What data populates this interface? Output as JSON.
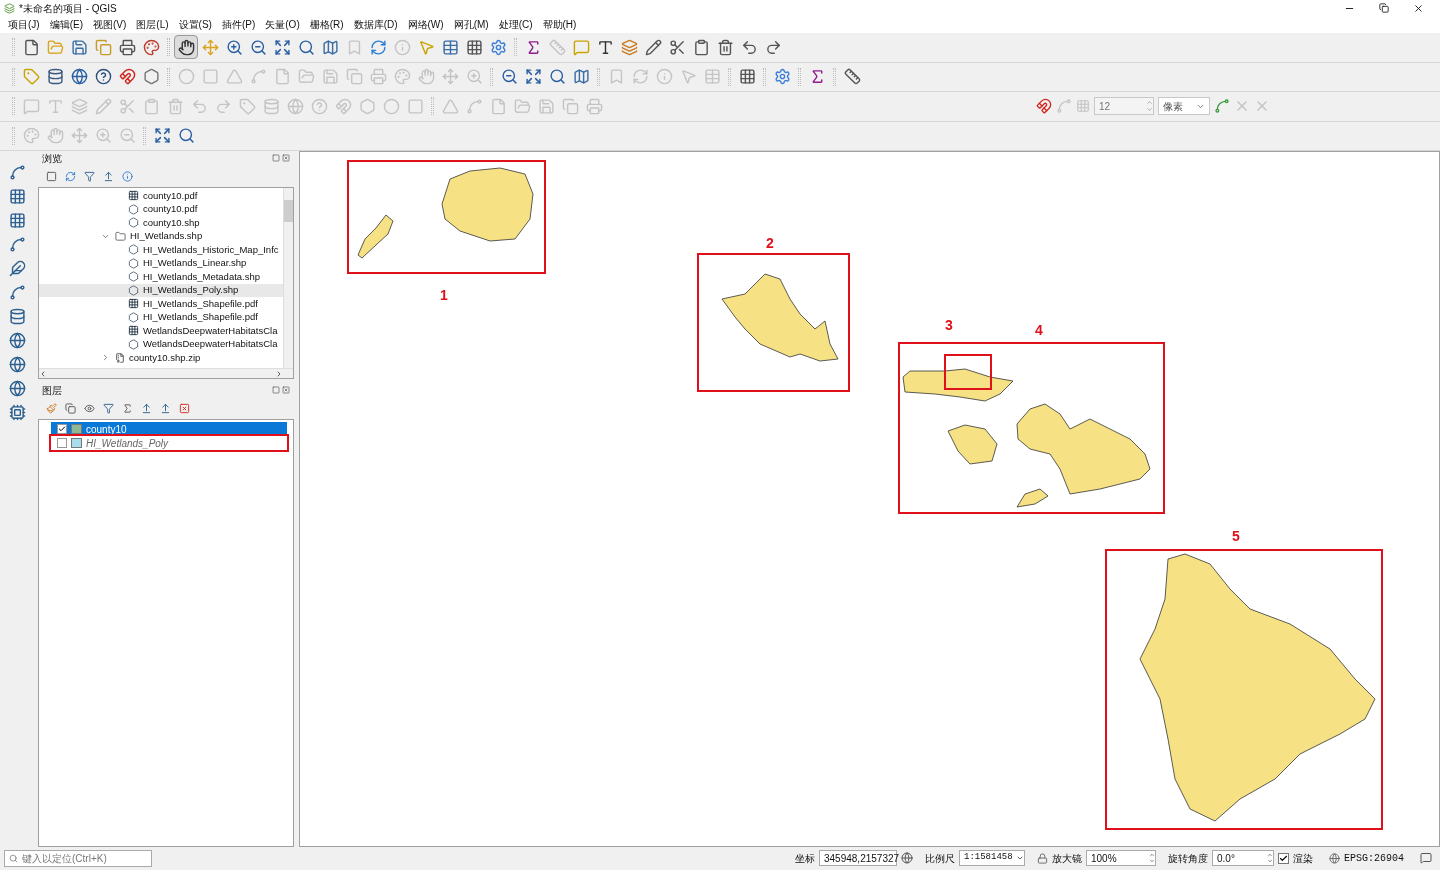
{
  "window": {
    "title": "*未命名的项目 - QGIS"
  },
  "menu": [
    "项目(J)",
    "编辑(E)",
    "视图(V)",
    "图层(L)",
    "设置(S)",
    "插件(P)",
    "矢量(O)",
    "栅格(R)",
    "数据库(D)",
    "网络(W)",
    "网孔(M)",
    "处理(C)",
    "帮助(H)"
  ],
  "toolbars": [
    {
      "groups": [
        [
          {
            "disabled": false,
            "pressed": false
          },
          {
            "disabled": false,
            "pressed": false
          },
          {
            "disabled": false,
            "pressed": false
          },
          {
            "disabled": false,
            "pressed": false
          },
          {
            "disabled": false,
            "pressed": false
          },
          {
            "disabled": false,
            "pressed": false
          }
        ],
        [
          {
            "disabled": false,
            "pressed": true
          },
          {
            "disabled": false,
            "pressed": false
          },
          {
            "disabled": false,
            "pressed": false
          },
          {
            "disabled": false,
            "pressed": false
          },
          {
            "disabled": false,
            "pressed": false
          },
          {
            "disabled": false,
            "pressed": false
          },
          {
            "disabled": false,
            "pressed": false
          },
          {
            "disabled": true,
            "pressed": false
          },
          {
            "disabled": false,
            "pressed": false
          },
          {
            "disabled": true,
            "pressed": false
          },
          {
            "disabled": false,
            "pressed": false
          },
          {
            "disabled": false,
            "pressed": false
          },
          {
            "disabled": false,
            "pressed": false
          },
          {
            "disabled": false,
            "pressed": false
          }
        ],
        [
          {
            "disabled": false,
            "pressed": false
          },
          {
            "disabled": true,
            "pressed": false
          },
          {
            "disabled": false,
            "pressed": false
          },
          {
            "disabled": false,
            "pressed": false
          },
          {
            "disabled": false,
            "pressed": false
          },
          {
            "disabled": false,
            "pressed": false
          },
          {
            "disabled": false,
            "pressed": false
          },
          {
            "disabled": false,
            "pressed": false
          },
          {
            "disabled": false,
            "pressed": false
          },
          {
            "disabled": false,
            "pressed": false
          },
          {
            "disabled": false,
            "pressed": false
          }
        ]
      ]
    },
    {
      "groups": [
        [
          {
            "disabled": false,
            "pressed": false
          },
          {
            "disabled": false,
            "pressed": false
          },
          {
            "disabled": false,
            "pressed": false
          },
          {
            "disabled": false,
            "pressed": false
          },
          {
            "disabled": false,
            "pressed": false
          },
          {
            "disabled": false,
            "pressed": false
          }
        ],
        [
          {
            "disabled": true,
            "pressed": false
          },
          {
            "disabled": true,
            "pressed": false
          },
          {
            "disabled": true,
            "pressed": false
          },
          {
            "disabled": true,
            "pressed": false
          },
          {
            "disabled": true,
            "pressed": false
          },
          {
            "disabled": true,
            "pressed": false
          },
          {
            "disabled": true,
            "pressed": false
          },
          {
            "disabled": true,
            "pressed": false
          },
          {
            "disabled": true,
            "pressed": false
          },
          {
            "disabled": true,
            "pressed": false
          },
          {
            "disabled": true,
            "pressed": false
          },
          {
            "disabled": true,
            "pressed": false
          },
          {
            "disabled": true,
            "pressed": false
          }
        ],
        [
          {
            "disabled": false,
            "pressed": false
          },
          {
            "disabled": false,
            "pressed": false
          },
          {
            "disabled": false,
            "pressed": false
          },
          {
            "disabled": false,
            "pressed": false
          }
        ],
        [
          {
            "disabled": true,
            "pressed": false
          },
          {
            "disabled": true,
            "pressed": false
          },
          {
            "disabled": true,
            "pressed": false
          },
          {
            "disabled": true,
            "pressed": false
          },
          {
            "disabled": true,
            "pressed": false
          }
        ],
        [
          {
            "disabled": false,
            "pressed": false
          }
        ],
        [
          {
            "disabled": false,
            "pressed": false
          }
        ],
        [
          {
            "disabled": false,
            "pressed": false
          }
        ],
        [
          {
            "disabled": false,
            "pressed": false
          }
        ]
      ]
    },
    {
      "groups": [
        [
          {
            "disabled": true,
            "pressed": false
          },
          {
            "disabled": true,
            "pressed": false
          },
          {
            "disabled": true,
            "pressed": false
          },
          {
            "disabled": true,
            "pressed": false
          },
          {
            "disabled": true,
            "pressed": false
          },
          {
            "disabled": true,
            "pressed": false
          },
          {
            "disabled": true,
            "pressed": false
          },
          {
            "disabled": true,
            "pressed": false
          },
          {
            "disabled": true,
            "pressed": false
          },
          {
            "disabled": true,
            "pressed": false
          },
          {
            "disabled": true,
            "pressed": false
          },
          {
            "disabled": true,
            "pressed": false
          },
          {
            "disabled": true,
            "pressed": false
          },
          {
            "disabled": true,
            "pressed": false
          },
          {
            "disabled": true,
            "pressed": false
          },
          {
            "disabled": true,
            "pressed": false
          },
          {
            "disabled": true,
            "pressed": false
          }
        ],
        [
          {
            "disabled": true,
            "pressed": false
          },
          {
            "disabled": true,
            "pressed": false
          },
          {
            "disabled": true,
            "pressed": false
          },
          {
            "disabled": true,
            "pressed": false
          },
          {
            "disabled": true,
            "pressed": false
          },
          {
            "disabled": true,
            "pressed": false
          },
          {
            "disabled": true,
            "pressed": false
          }
        ]
      ]
    },
    {
      "groups": [
        [
          {
            "disabled": true,
            "pressed": false
          },
          {
            "disabled": true,
            "pressed": false
          },
          {
            "disabled": true,
            "pressed": false
          },
          {
            "disabled": true,
            "pressed": false
          },
          {
            "disabled": true,
            "pressed": false
          }
        ],
        [
          {
            "disabled": false,
            "pressed": false
          },
          {
            "disabled": false,
            "pressed": false
          }
        ]
      ]
    }
  ],
  "snapping": {
    "tolerance": "12",
    "unit": "像素"
  },
  "browser": {
    "title": "浏览",
    "tree": [
      {
        "children": [
          {
            "label": "county10.pdf",
            "kind": "raster",
            "selected": false
          },
          {
            "label": "county10.pdf",
            "kind": "vector",
            "selected": false
          },
          {
            "label": "county10.shp",
            "kind": "vector",
            "selected": false
          }
        ]
      },
      {
        "label": "HI_Wetlands.shp",
        "kind": "folder",
        "expanded": true,
        "selected": false,
        "children": [
          {
            "label": "HI_Wetlands_Historic_Map_Infc",
            "kind": "vector",
            "selected": false
          },
          {
            "label": "HI_Wetlands_Linear.shp",
            "kind": "vector",
            "selected": false
          },
          {
            "label": "HI_Wetlands_Metadata.shp",
            "kind": "vector",
            "selected": false
          },
          {
            "label": "HI_Wetlands_Poly.shp",
            "kind": "vector",
            "selected": true
          },
          {
            "label": "HI_Wetlands_Shapefile.pdf",
            "kind": "raster",
            "selected": false
          },
          {
            "label": "HI_Wetlands_Shapefile.pdf",
            "kind": "vector",
            "selected": false
          },
          {
            "label": "WetlandsDeepwaterHabitatsCla",
            "kind": "raster",
            "selected": false
          },
          {
            "label": "WetlandsDeepwaterHabitatsCla",
            "kind": "vector",
            "selected": false
          }
        ]
      },
      {
        "label": "county10.shp.zip",
        "kind": "zip",
        "expanded": false,
        "selected": false
      }
    ]
  },
  "layers": {
    "title": "图层",
    "items": [
      {
        "name": "county10",
        "checked": true,
        "selected": true,
        "color": "#8fb996",
        "highlighted": false
      },
      {
        "name": "HI_Wetlands_Poly",
        "checked": false,
        "selected": false,
        "color": "#a9dcec",
        "highlighted": true
      }
    ]
  },
  "map_annotations": [
    {
      "label": "1"
    },
    {
      "label": "2"
    },
    {
      "label": "3"
    },
    {
      "label": "4"
    },
    {
      "label": "5"
    }
  ],
  "status_bar": {
    "locator_placeholder": "键入以定位(Ctrl+K)",
    "coordinate_label": "坐标",
    "coordinate": "345948,2157327",
    "scale_label": "比例尺",
    "scale": "1:1581458",
    "magnifier_label": "放大镜",
    "magnifier": "100%",
    "rotation_label": "旋转角度",
    "rotation": "0.0°",
    "render_label": "渲染",
    "render": true,
    "crs": "EPSG:26904"
  }
}
